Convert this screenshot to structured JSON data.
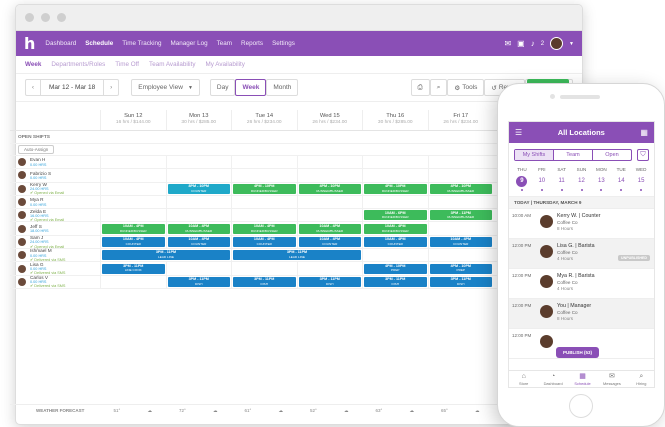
{
  "nav": {
    "logo": "h",
    "items": [
      "Dashboard",
      "Schedule",
      "Time Tracking",
      "Manager Log",
      "Team",
      "Reports",
      "Settings"
    ],
    "badge": "2"
  },
  "subnav": [
    "Week",
    "Departments/Roles",
    "Time Off",
    "Team Availability",
    "My Availability"
  ],
  "toolbar": {
    "date_range": "Mar 12 - Mar 18",
    "view_select": "Employee View",
    "views": [
      "Day",
      "Week",
      "Month"
    ],
    "tools": "Tools",
    "revert": "Revert",
    "copy": "Co"
  },
  "grid": {
    "days": [
      {
        "d": "Sun 12",
        "s": "16 hrs / $144.00"
      },
      {
        "d": "Mon 13",
        "s": "30 hrs / $285.00"
      },
      {
        "d": "Tue 14",
        "s": "26 hrs / $234.00"
      },
      {
        "d": "Wed 15",
        "s": "26 hrs / $234.00"
      },
      {
        "d": "Thu 16",
        "s": "30 hrs / $285.00"
      },
      {
        "d": "Fri 17",
        "s": "26 hrs / $234.00"
      }
    ],
    "open_shifts": "OPEN SHIFTS",
    "auto_assign": "Auto-Assign",
    "weather_label": "WEATHER FORECAST",
    "weather": [
      "51°",
      "72°",
      "61°",
      "52°",
      "63°",
      "65°"
    ]
  },
  "employees": [
    {
      "name": "Evan H",
      "hrs": "0.00 HRS",
      "note": "",
      "shifts": [
        null,
        null,
        null,
        null,
        null,
        null
      ]
    },
    {
      "name": "Fabrizio S",
      "hrs": "0.00 HRS",
      "note": "",
      "shifts": [
        null,
        null,
        null,
        null,
        null,
        null
      ]
    },
    {
      "name": "Kerry W",
      "hrs": "24.00 HRS",
      "note": "✔ Opened via Email",
      "shifts": [
        null,
        {
          "t": "8PM - 10PM",
          "r": "COUNTER",
          "c": "teal"
        },
        {
          "t": "4PM - 10PM",
          "r": "RUNNER/BUSSER",
          "c": "green"
        },
        {
          "t": "4PM - 10PM",
          "r": "RUNNER/BUSSER",
          "c": "green"
        },
        {
          "t": "4PM - 10PM",
          "r": "RUNNER/BUSSER",
          "c": "green"
        },
        {
          "t": "4PM - 10PM",
          "r": "RUNNER/BUSSER",
          "c": "green"
        }
      ]
    },
    {
      "name": "Mya R",
      "hrs": "0.00 HRS",
      "note": "",
      "shifts": [
        null,
        null,
        null,
        null,
        null,
        null
      ]
    },
    {
      "name": "Zelda E",
      "hrs": "16.00 HRS",
      "note": "✔ Opened via Email",
      "shifts": [
        null,
        null,
        null,
        null,
        {
          "t": "10AM - 6PM",
          "r": "RUNNER/BUSSER",
          "c": "green"
        },
        {
          "t": "3PM - 11PM",
          "r": "RUNNER/BUSSER",
          "c": "green"
        }
      ]
    },
    {
      "name": "Jeff S",
      "hrs": "18.00 HRS",
      "note": "",
      "shifts": [
        {
          "t": "10AM - 4PM",
          "r": "RUNNER/BUSSER",
          "c": "green"
        },
        {
          "t": "10AM - 4PM",
          "r": "RUNNER/BUSSER",
          "c": "green"
        },
        {
          "t": "10AM - 4PM",
          "r": "RUNNER/BUSSER",
          "c": "green"
        },
        {
          "t": "10AM - 4PM",
          "r": "RUNNER/BUSSER",
          "c": "green"
        },
        {
          "t": "10AM - 4PM",
          "r": "RUNNER/BUSSER",
          "c": "green"
        },
        null
      ]
    },
    {
      "name": "Sam J",
      "hrs": "24.00 HRS",
      "note": "✔ Opened via Email",
      "shifts": [
        {
          "t": "10AM - 4PM",
          "r": "COUNTER",
          "c": "blue"
        },
        {
          "t": "10AM - 4PM",
          "r": "COUNTER",
          "c": "blue"
        },
        {
          "t": "10AM - 4PM",
          "r": "COUNTER",
          "c": "blue"
        },
        {
          "t": "10AM - 4PM",
          "r": "COUNTER",
          "c": "blue"
        },
        {
          "t": "10AM - 4PM",
          "r": "COUNTER",
          "c": "blue"
        },
        {
          "t": "10AM - 4PM",
          "r": "COUNTER",
          "c": "blue"
        }
      ]
    },
    {
      "name": "Ishmael M",
      "hrs": "0.00 HRS",
      "note": "✔ Delivered via SMS",
      "shifts": [
        {
          "t": "3PM - 11PM",
          "r": "LEAD LINE",
          "c": "blue",
          "span": 2
        },
        null,
        {
          "t": "3PM - 11PM",
          "r": "LEAD LINE",
          "c": "blue",
          "span": 2
        },
        null,
        null,
        null
      ]
    },
    {
      "name": "Lisa G",
      "hrs": "0.00 HRS",
      "note": "✔ Delivered via SMS",
      "shifts": [
        {
          "t": "3PM - 11PM",
          "r": "LINE COOK",
          "c": "blue"
        },
        null,
        null,
        null,
        {
          "t": "4PM - 10PM",
          "r": "PREP",
          "c": "blue"
        },
        {
          "t": "4PM - 10PM",
          "r": "PREP",
          "c": "blue"
        }
      ]
    },
    {
      "name": "Carlos V",
      "hrs": "0.00 HRS",
      "note": "✔ Delivered via SMS",
      "shifts": [
        null,
        {
          "t": "3PM - 11PM",
          "r": "DISH",
          "c": "blue"
        },
        {
          "t": "3PM - 11PM",
          "r": "DISH",
          "c": "blue"
        },
        {
          "t": "3PM - 11PM",
          "r": "DISH",
          "c": "blue"
        },
        {
          "t": "3PM - 11PM",
          "r": "DISH",
          "c": "blue"
        },
        {
          "t": "3PM - 11PM",
          "r": "DISH",
          "c": "blue"
        }
      ]
    }
  ],
  "mobile": {
    "title": "All Locations",
    "tabs": [
      "My Shifts",
      "Team",
      "Open"
    ],
    "week": [
      {
        "dn": "THU",
        "dd": "9",
        "sel": true
      },
      {
        "dn": "FRI",
        "dd": "10"
      },
      {
        "dn": "SAT",
        "dd": "11"
      },
      {
        "dn": "SUN",
        "dd": "12"
      },
      {
        "dn": "MON",
        "dd": "13"
      },
      {
        "dn": "TUE",
        "dd": "14"
      },
      {
        "dn": "WED",
        "dd": "15"
      }
    ],
    "date_header": "TODAY | THURSDAY, MARCH 9",
    "shifts": [
      {
        "time": "10:00 AM",
        "name": "Kerry W.  |  Counter",
        "co": "Coffee Co",
        "hrs": "8 Hours",
        "badge": ""
      },
      {
        "time": "12:00 PM",
        "name": "Lisa G.  |  Barista",
        "co": "Coffee Co",
        "hrs": "4 Hours",
        "badge": "UNPUBLISHED"
      },
      {
        "time": "12:00 PM",
        "name": "Mya R.  |  Barista",
        "co": "Coffee Co",
        "hrs": "4 Hours",
        "badge": ""
      },
      {
        "time": "12:00 PM",
        "name": "You  |  Manager",
        "co": "Coffee Co",
        "hrs": "8 Hours",
        "badge": ""
      },
      {
        "time": "12:00 PM",
        "name": "",
        "co": "",
        "hrs": "",
        "badge": ""
      }
    ],
    "publish": "PUBLISH (53)",
    "bottom": [
      "Store",
      "Dashboard",
      "Schedule",
      "Messages",
      "Hiring"
    ]
  }
}
